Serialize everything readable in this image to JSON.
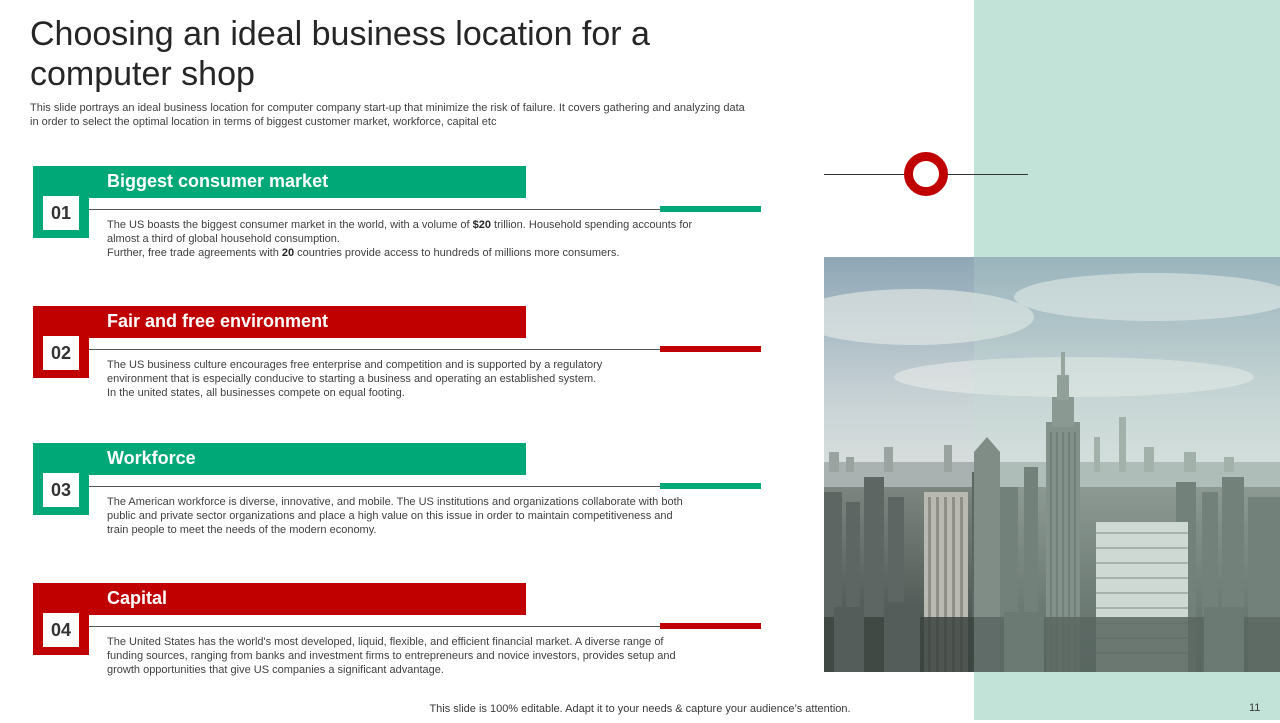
{
  "title": "Choosing an ideal business location for a computer shop",
  "subtitle": "This slide portrays an ideal business location for computer  company start-up that minimize the risk of failure. It covers gathering and analyzing data in order to select the optimal location in terms of biggest customer market, workforce, capital etc",
  "colors": {
    "green": "#00a878",
    "red": "#c00000",
    "side_band": "#c2e3d8"
  },
  "items": [
    {
      "number": "01",
      "heading": "Biggest consumer market",
      "color": "green",
      "text_a": "The US boasts the biggest consumer market in the world, with a volume of ",
      "bold_a": "$20",
      "text_b": " trillion. Household spending accounts for almost a third of global household consumption.",
      "text_c": "Further, free trade agreements with ",
      "bold_b": "20",
      "text_d": " countries provide access to hundreds of millions more consumers."
    },
    {
      "number": "02",
      "heading": "Fair and free environment",
      "color": "red",
      "text": "The US business culture encourages free enterprise and competition and is supported by a regulatory environment that is especially conducive to starting a business and operating an established system. In the united states, all businesses compete on equal footing."
    },
    {
      "number": "03",
      "heading": "Workforce",
      "color": "green",
      "text": "The American workforce is diverse, innovative, and mobile. The US institutions and organizations collaborate with both public and private  sector organizations and place a high value on this issue in order to maintain competitiveness and train people to meet the needs of the modern economy."
    },
    {
      "number": "04",
      "heading": "Capital",
      "color": "red",
      "text": "The United States has the world's most developed, liquid, flexible, and efficient financial market. A diverse range of funding sources, ranging from banks and investment firms to entrepreneurs and novice investors, provides setup and growth opportunities that give US companies a significant advantage."
    }
  ],
  "footer": "This slide is 100% editable. Adapt it to your needs & capture your audience’s attention.",
  "page_number": "11"
}
